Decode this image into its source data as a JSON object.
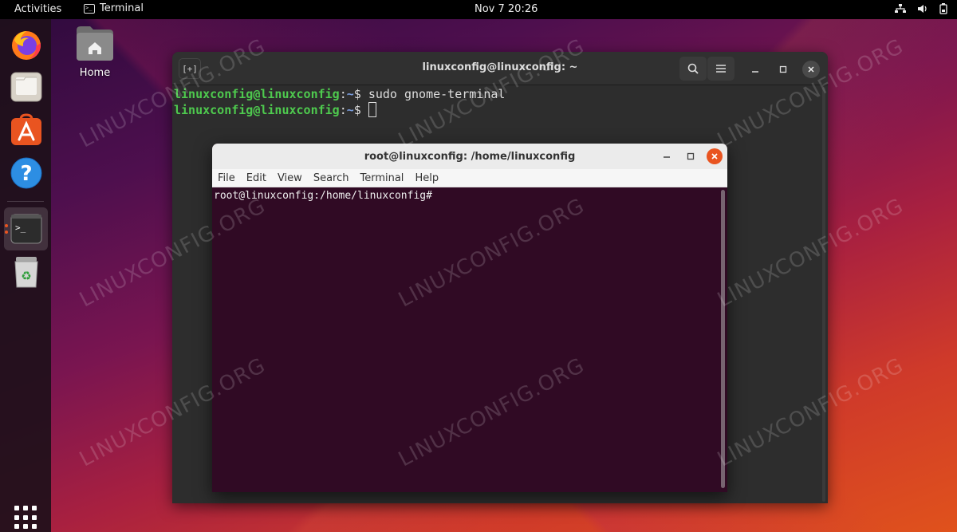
{
  "topbar": {
    "activities": "Activities",
    "app_name": "Terminal",
    "clock": "Nov 7  20:26",
    "tray_icons": [
      "network-icon",
      "volume-icon",
      "battery-icon"
    ]
  },
  "dock": {
    "items": [
      {
        "name": "firefox-icon"
      },
      {
        "name": "files-icon"
      },
      {
        "name": "software-icon"
      },
      {
        "name": "help-icon"
      },
      {
        "name": "terminal-icon",
        "running": true
      },
      {
        "name": "trash-icon"
      }
    ],
    "apps_grid": "show-apps-icon"
  },
  "desktop": {
    "home_label": "Home"
  },
  "main_terminal": {
    "title": "linuxconfig@linuxconfig: ~",
    "new_tab_label": "[+]",
    "lines": [
      {
        "user": "linuxconfig@linuxconfig",
        "sep": ":",
        "path": "~",
        "dollar": "$ ",
        "cmd": "sudo gnome-terminal"
      },
      {
        "user": "linuxconfig@linuxconfig",
        "sep": ":",
        "path": "~",
        "dollar": "$ ",
        "cmd": ""
      }
    ]
  },
  "root_terminal": {
    "title": "root@linuxconfig: /home/linuxconfig",
    "menu": [
      "File",
      "Edit",
      "View",
      "Search",
      "Terminal",
      "Help"
    ],
    "prompt": "root@linuxconfig:/home/linuxconfig#"
  },
  "watermark": "LINUXCONFIG.ORG",
  "colors": {
    "accent": "#e95420",
    "prompt_user": "#4ec94e",
    "prompt_path": "#7a9ee0",
    "root_term_bg": "#300a24"
  }
}
